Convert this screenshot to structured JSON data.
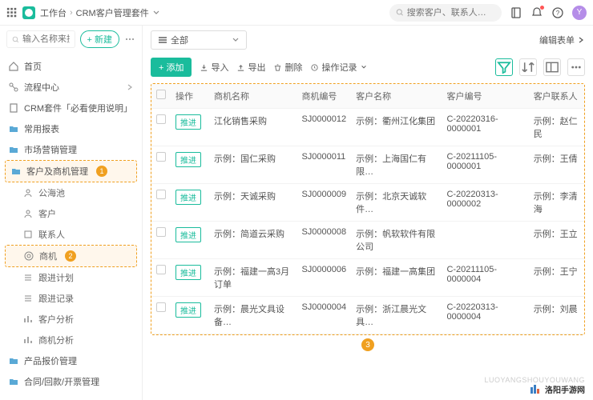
{
  "top": {
    "workspace": "工作台",
    "suite": "CRM客户管理套件",
    "search_placeholder": "搜索客户、联系人…",
    "avatar_letter": "Y"
  },
  "side_search_placeholder": "输入名称来搜索",
  "btn_new": "+ 新建",
  "nav": {
    "home": "首页",
    "flow": "流程中心",
    "crm_kit": "CRM套件「必看使用说明」",
    "reports": "常用报表",
    "marketing": "市场营销管理",
    "customer_mgmt": "客户及商机管理",
    "pool": "公海池",
    "customer": "客户",
    "contact": "联系人",
    "opportunity": "商机",
    "follow_plan": "跟进计划",
    "follow_record": "跟进记录",
    "customer_analysis": "客户分析",
    "opportunity_analysis": "商机分析",
    "product_quote": "产品报价管理",
    "contract": "合同/回款/开票管理"
  },
  "badges": {
    "b1": "1",
    "b2": "2",
    "b3": "3"
  },
  "view": {
    "all": "全部",
    "edit_form": "编辑表单"
  },
  "toolbar": {
    "add": "+ 添加",
    "import": "导入",
    "export": "导出",
    "delete": "删除",
    "op_log": "操作记录"
  },
  "columns": {
    "op": "操作",
    "opp_name": "商机名称",
    "opp_code": "商机编号",
    "cust_name": "客户名称",
    "cust_code": "客户编号",
    "contact": "客户联系人"
  },
  "op_btn": "推进",
  "rows": [
    {
      "name": "江化销售采购",
      "code": "SJ0000012",
      "cust": "示例：衢州江化集团",
      "ccode": "C-20220316-0000001",
      "contact": "示例：赵仁民"
    },
    {
      "name": "示例：国仁采购",
      "code": "SJ0000011",
      "cust": "示例：上海国仁有限…",
      "ccode": "C-20211105-0000001",
      "contact": "示例：王倩"
    },
    {
      "name": "示例：天诚采购",
      "code": "SJ0000009",
      "cust": "示例：北京天诚软件…",
      "ccode": "C-20220313-0000002",
      "contact": "示例：李清海"
    },
    {
      "name": "示例：简道云采购",
      "code": "SJ0000008",
      "cust": "示例：帆软软件有限公司",
      "ccode": "",
      "contact": "示例：王立"
    },
    {
      "name": "示例：福建一高3月订单",
      "code": "SJ0000006",
      "cust": "示例：福建一高集团",
      "ccode": "C-20211105-0000004",
      "contact": "示例：王宁"
    },
    {
      "name": "示例：晨光文具设备…",
      "code": "SJ0000004",
      "cust": "示例：浙江晨光文具…",
      "ccode": "C-20220313-0000004",
      "contact": "示例：刘晨"
    }
  ],
  "watermark": {
    "site": "洛阳手游网",
    "url": "LUOYANGSHOUYOUWANG"
  }
}
